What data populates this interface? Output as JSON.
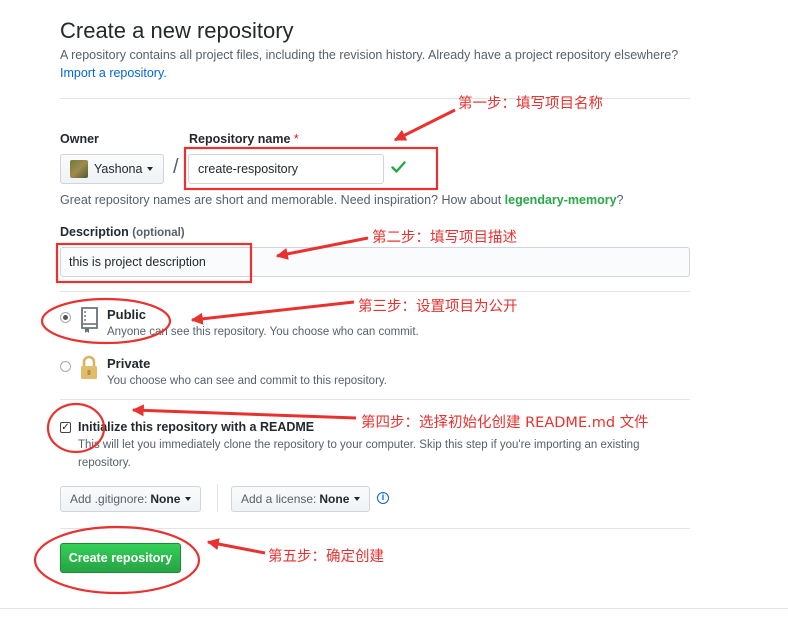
{
  "header": {
    "title": "Create a new repository",
    "subtitle": "A repository contains all project files, including the revision history. Already have a project repository elsewhere?",
    "import_link": "Import a repository."
  },
  "owner": {
    "label": "Owner",
    "value": "Yashona"
  },
  "repo_name": {
    "label": "Repository name",
    "required_mark": "*",
    "value": "create-respository",
    "separator": "/"
  },
  "name_hint": {
    "prefix": "Great repository names are short and memorable. Need inspiration? How about ",
    "suggestion": "legendary-memory",
    "suffix": "?"
  },
  "description": {
    "label": "Description",
    "optional": "(optional)",
    "value": "this is project description"
  },
  "visibility": {
    "public": {
      "title": "Public",
      "desc": "Anyone can see this repository. You choose who can commit."
    },
    "private": {
      "title": "Private",
      "desc": "You choose who can see and commit to this repository."
    },
    "selected": "public"
  },
  "readme": {
    "checked": true,
    "label": "Initialize this repository with a README",
    "desc_line1": "This will let you immediately clone the repository to your computer. Skip this step if you're importing an existing",
    "desc_line2": "repository."
  },
  "gitignore": {
    "label": "Add .gitignore:",
    "value": "None"
  },
  "license": {
    "label": "Add a license:",
    "value": "None"
  },
  "info_icon": "i",
  "submit": {
    "label": "Create repository"
  },
  "annotations": {
    "step1": "第一步：填写项目名称",
    "step2": "第二步：填写项目描述",
    "step3": "第三步：设置项目为公开",
    "step4": "第四步：选择初始化创建 README.md 文件",
    "step5": "第五步：确定创建"
  },
  "colors": {
    "annotation": "#e8322f",
    "link": "#0366d6",
    "primary": "#28a745"
  }
}
